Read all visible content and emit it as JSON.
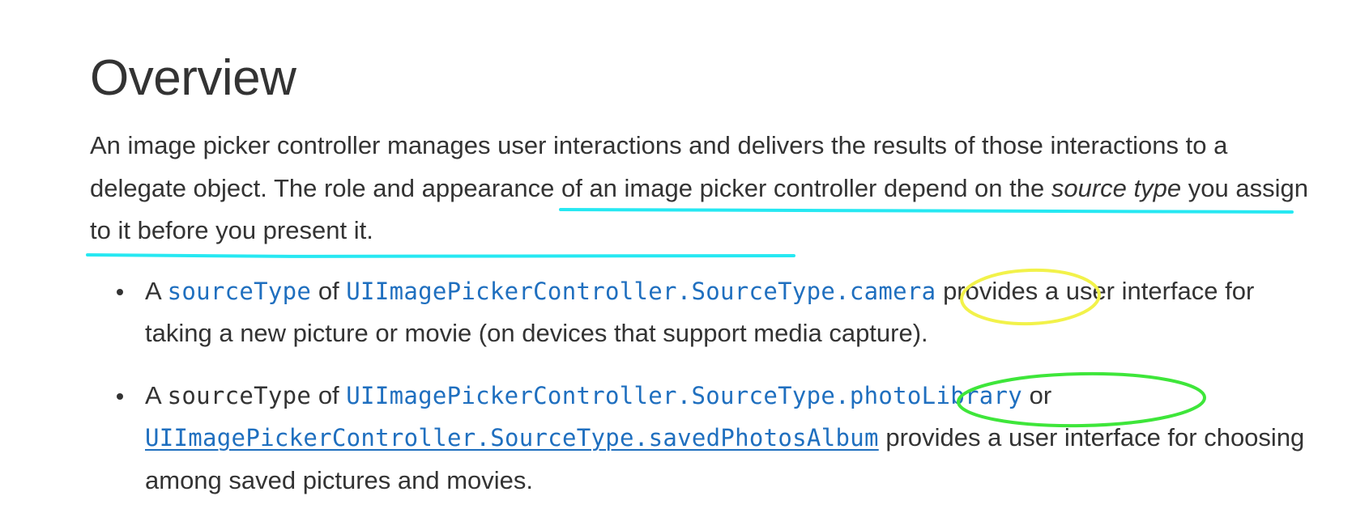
{
  "overview": {
    "heading": "Overview",
    "intro": {
      "part1": "An image picker controller manages user interactions and delivers the results of those interactions to a delegate object. The role and appearance of an image picker controller depend on the ",
      "emphasis": "source type",
      "part2": " you assign to it before you present it."
    }
  },
  "bullets": [
    {
      "a": "A ",
      "code1": "sourceType",
      "of": " of ",
      "code2": "UIImagePickerController.SourceType",
      "code3": ".camera",
      "text": " provides a user interface for taking a new picture or movie (on devices that support media capture)."
    },
    {
      "a": "A ",
      "code1": "sourceType",
      "of": " of ",
      "code2": "UIImagePickerController.SourceType",
      "code3": ".photoLibrary",
      "or": " or ",
      "code4": "UIImagePickerController.SourceType.savedPhotosAlbum",
      "text": " provides a user interface for choosing among saved pictures and movies."
    }
  ],
  "annotation_colors": {
    "underline": "#26e8f2",
    "camera_circle": "#f2f24a",
    "photo_library_circle": "#3ee63a"
  }
}
